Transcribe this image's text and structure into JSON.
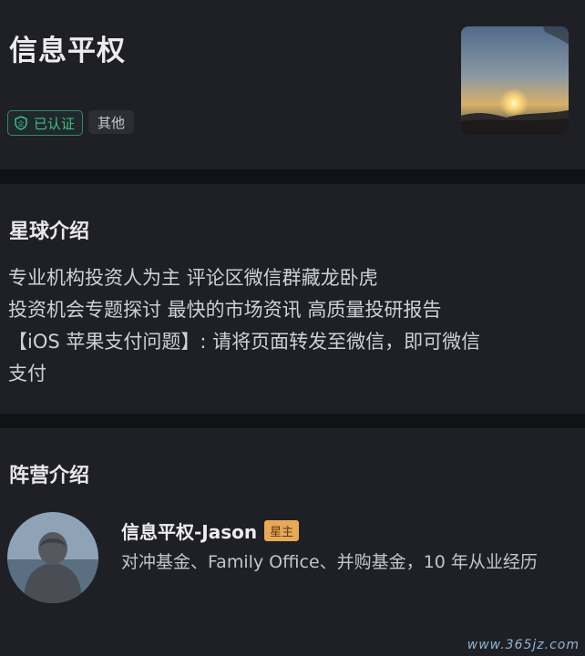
{
  "header": {
    "title": "信息平权",
    "verified_label": "已认证",
    "category_label": "其他",
    "verified_icon": "shield-enterprise-icon"
  },
  "intro": {
    "section_title": "星球介绍",
    "lines": [
      "专业机构投资人为主  评论区微信群藏龙卧虎",
      "投资机会专题探讨   最快的市场资讯  高质量投研报告",
      "【iOS 苹果支付问题】: 请将页面转发至微信，即可微信",
      "支付"
    ]
  },
  "camp": {
    "section_title": "阵营介绍",
    "owner_name": "信息平权-Jason",
    "owner_tag": "星主",
    "owner_bio": "对冲基金、Family Office、并购基金，10 年从业经历"
  },
  "watermark": "www.365jz.com",
  "colors": {
    "background": "#111216",
    "card": "#1f2026",
    "verified_green": "#3fbf84",
    "owner_tag_bg": "#e8a85a"
  }
}
